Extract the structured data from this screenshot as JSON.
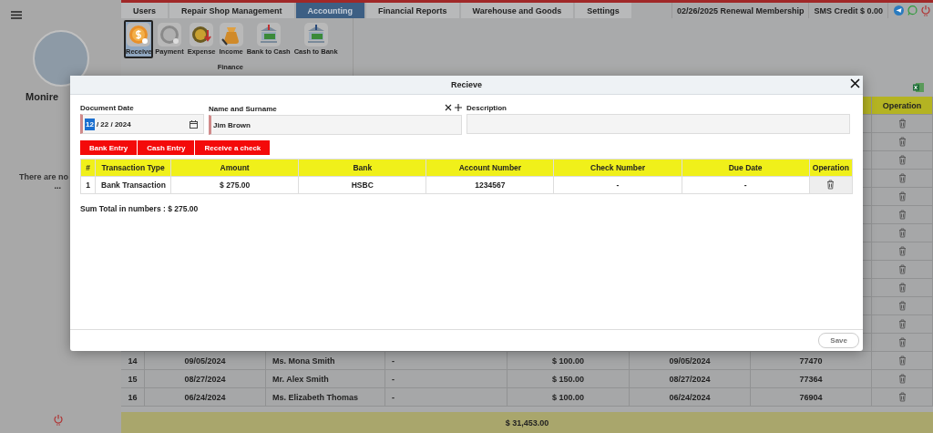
{
  "sidebar": {
    "user_name": "Monire",
    "message": "There are no",
    "message_more": "..."
  },
  "top_tabs": [
    {
      "label": "Users",
      "selected": false
    },
    {
      "label": "Repair Shop Management",
      "selected": false
    },
    {
      "label": "Accounting",
      "selected": true
    },
    {
      "label": "Financial Reports",
      "selected": false
    },
    {
      "label": "Warehouse and Goods",
      "selected": false
    },
    {
      "label": "Settings",
      "selected": false
    }
  ],
  "status": {
    "renewal": "02/26/2025 Renewal Membership",
    "sms_credit": "SMS Credit $ 0.00"
  },
  "ribbon": {
    "group": "Finance",
    "items": [
      {
        "label": "Receive",
        "selected": true
      },
      {
        "label": "Payment",
        "selected": false
      },
      {
        "label": "Expense",
        "selected": false
      },
      {
        "label": "Income",
        "selected": false
      },
      {
        "label": "Bank to Cash",
        "selected": false
      },
      {
        "label": "Cash to Bank",
        "selected": false
      }
    ]
  },
  "background_table": {
    "visible_header": "Operation",
    "rows": [
      {
        "covered": true
      },
      {
        "covered": true
      },
      {
        "covered": true
      },
      {
        "covered": true
      },
      {
        "covered": true
      },
      {
        "covered": true
      },
      {
        "covered": true
      },
      {
        "covered": true
      },
      {
        "covered": true
      },
      {
        "covered": true
      },
      {
        "covered": true
      },
      {
        "covered": true
      },
      {
        "covered": true
      },
      {
        "covered": false,
        "cells": [
          "14",
          "09/05/2024",
          "Ms. Mona Smith",
          "-",
          "$ 100.00",
          "09/05/2024",
          "77470"
        ]
      },
      {
        "covered": false,
        "cells": [
          "15",
          "08/27/2024",
          "Mr. Alex Smith",
          "-",
          "$ 150.00",
          "08/27/2024",
          "77364"
        ]
      },
      {
        "covered": false,
        "cells": [
          "16",
          "06/24/2024",
          "Ms. Elizabeth Thomas",
          "-",
          "$ 100.00",
          "06/24/2024",
          "76904"
        ]
      }
    ],
    "total": "$ 31,453.00"
  },
  "modal": {
    "title": "Recieve",
    "document_date": {
      "label": "Document Date",
      "month": "12",
      "rest": "/ 22 / 2024"
    },
    "name": {
      "label": "Name and Surname",
      "value": "Jim Brown"
    },
    "description": {
      "label": "Description"
    },
    "entry_buttons": [
      "Bank Entry",
      "Cash Entry",
      "Receive a check"
    ],
    "table": {
      "columns": [
        "#",
        "Transaction Type",
        "Amount",
        "Bank",
        "Account Number",
        "Check Number",
        "Due Date",
        "Operation"
      ],
      "rows": [
        {
          "cells": [
            "1",
            "Bank Transaction",
            "$ 275.00",
            "HSBC",
            "1234567",
            "-",
            "-"
          ]
        }
      ]
    },
    "sum": "Sum Total in numbers : $ 275.00",
    "save": "Save"
  }
}
